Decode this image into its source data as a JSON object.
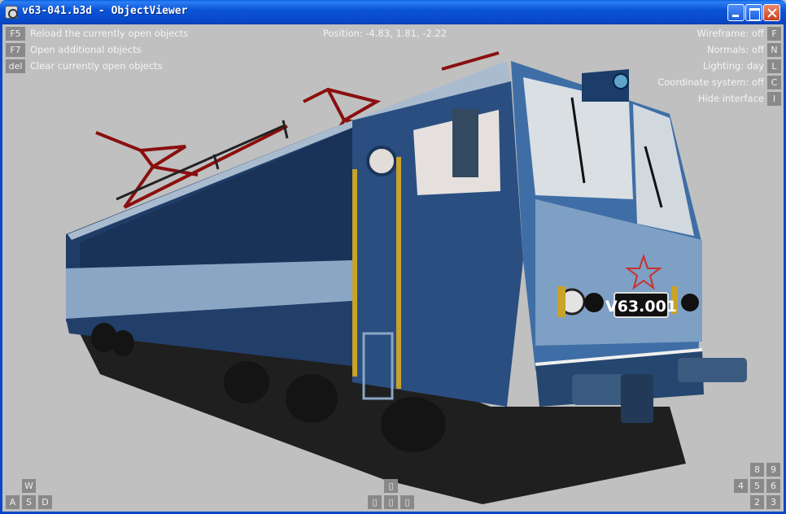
{
  "window": {
    "title": "v63-041.b3d - ObjectViewer"
  },
  "left_commands": [
    {
      "key": "F5",
      "label": "Reload the currently open objects"
    },
    {
      "key": "F7",
      "label": "Open additional objects"
    },
    {
      "key": "del",
      "label": "Clear currently open objects"
    }
  ],
  "position_readout": "Position: -4.83, 1.81, -2.22",
  "right_toggles": [
    {
      "label": "Wireframe: off",
      "key": "F"
    },
    {
      "label": "Normals: off",
      "key": "N"
    },
    {
      "label": "Lighting: day",
      "key": "L"
    },
    {
      "label": "Coordinate system: off",
      "key": "C"
    },
    {
      "label": "Hide interface",
      "key": "I"
    }
  ],
  "move_keys": {
    "w": "W",
    "a": "A",
    "s": "S",
    "d": "D"
  },
  "arrow_keys": {
    "up": "▯",
    "left": "▯",
    "down": "▯",
    "right": "▯"
  },
  "numpad_keys": {
    "k8": "8",
    "k9": "9",
    "k4": "4",
    "k5": "5",
    "k6": "6",
    "k2": "2",
    "k3": "3"
  },
  "model": {
    "number_plate": "V63.001",
    "body_color": "#2a4e80",
    "stripe_color": "#8aa6c4",
    "pantograph_color": "#8a0f0f"
  }
}
